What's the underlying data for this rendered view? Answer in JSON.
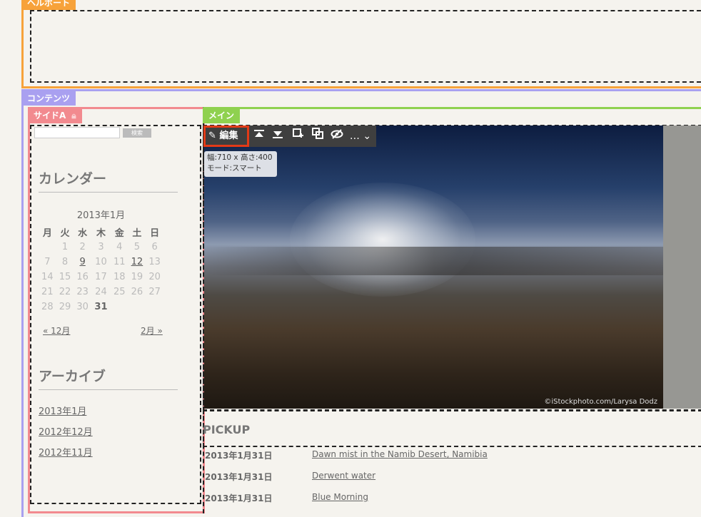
{
  "areas": {
    "helpbox": "ヘルボート",
    "contents": "コンテンツ",
    "side": "サイドA",
    "main": "メイン"
  },
  "search": {
    "button": "検索"
  },
  "calendar": {
    "title": "カレンダー",
    "caption": "2013年1月",
    "weekdays": [
      "月",
      "火",
      "水",
      "木",
      "金",
      "土",
      "日"
    ],
    "weeks": [
      [
        "",
        "1",
        "2",
        "3",
        "4",
        "5",
        "6"
      ],
      [
        "7",
        "8",
        "9",
        "10",
        "11",
        "12",
        "13"
      ],
      [
        "14",
        "15",
        "16",
        "17",
        "18",
        "19",
        "20"
      ],
      [
        "21",
        "22",
        "23",
        "24",
        "25",
        "26",
        "27"
      ],
      [
        "28",
        "29",
        "30",
        "31",
        "",
        "",
        ""
      ]
    ],
    "linked_days": [
      "9",
      "12"
    ],
    "today": "31",
    "prev": "« 12月",
    "next": "2月 »"
  },
  "archive": {
    "title": "アーカイブ",
    "items": [
      "2013年1月",
      "2012年12月",
      "2012年11月"
    ]
  },
  "toolbar": {
    "edit": "編集",
    "more": "…"
  },
  "image_info": {
    "size": "幅:710 x 高さ:400",
    "mode": "モード:スマート",
    "credit": "©iStockphoto.com/Larysa Dodz"
  },
  "pickup": {
    "title": "PICKUP",
    "items": [
      {
        "date": "2013年1月31日",
        "title": "Dawn mist in the Namib Desert, Namibia"
      },
      {
        "date": "2013年1月31日",
        "title": "Derwent water"
      },
      {
        "date": "2013年1月31日",
        "title": "Blue Morning"
      }
    ]
  }
}
